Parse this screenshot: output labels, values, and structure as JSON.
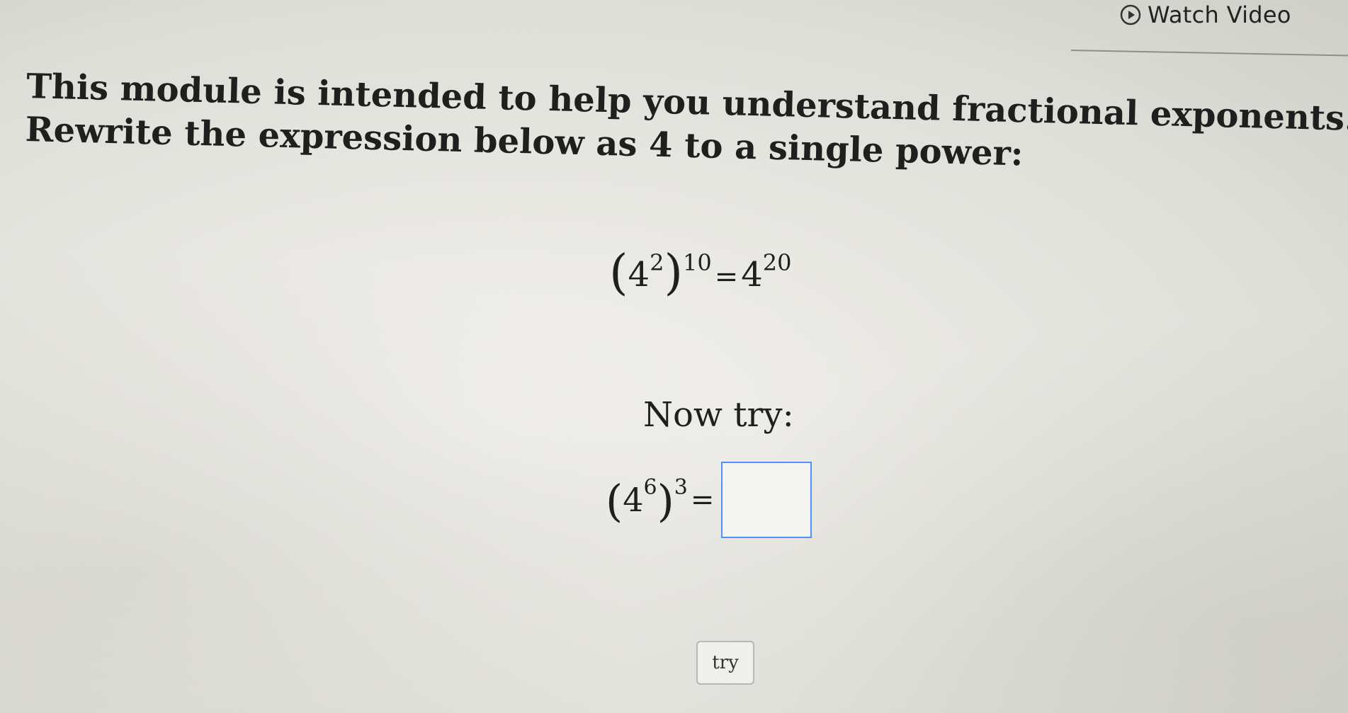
{
  "header": {
    "watch_video_label": "Watch Video"
  },
  "content": {
    "intro_line": "This module is intended to help you understand fractional exponents.",
    "instruction_line": "Rewrite the expression below as 4 to a single power:",
    "example": {
      "base": "4",
      "inner_exponent": "2",
      "outer_exponent": "10",
      "equals": "=",
      "result_base": "4",
      "result_exponent": "20"
    },
    "now_try_label": "Now try:",
    "practice": {
      "base": "4",
      "inner_exponent": "6",
      "outer_exponent": "3",
      "equals": "=",
      "answer_value": ""
    },
    "try_button_label": "try"
  },
  "colors": {
    "input_border": "#4d90fe",
    "text": "#1f1f1f"
  }
}
